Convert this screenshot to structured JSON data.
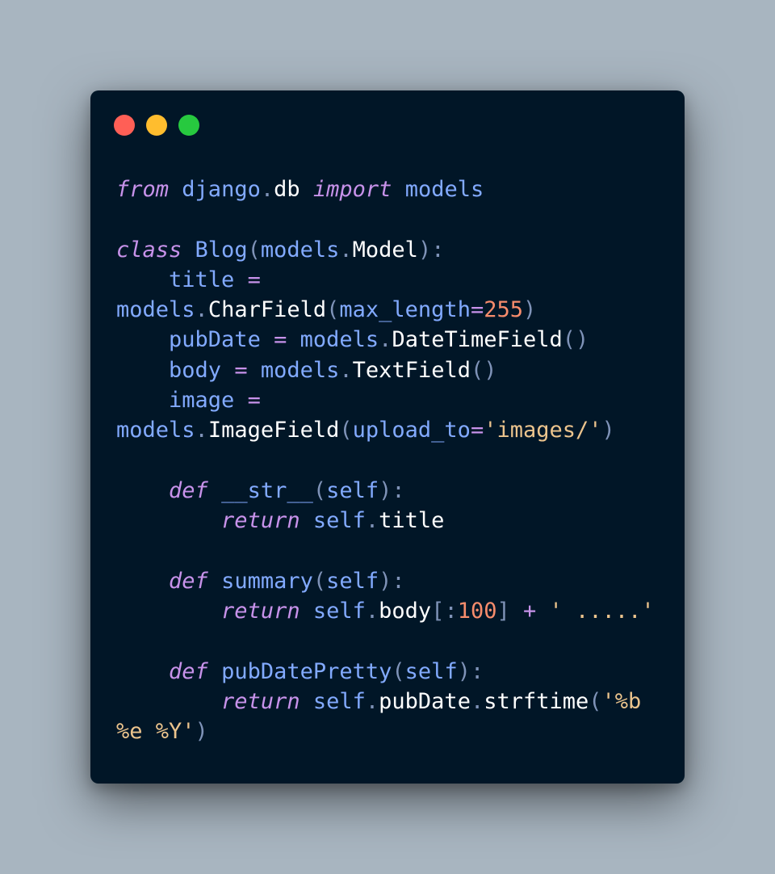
{
  "window": {
    "controls": [
      {
        "name": "close",
        "color": "#ff5f56"
      },
      {
        "name": "minimize",
        "color": "#ffbd2e"
      },
      {
        "name": "maximize",
        "color": "#27c93f"
      }
    ]
  },
  "code": {
    "lines": [
      [
        [
          "kw",
          "from"
        ],
        [
          "pl",
          " "
        ],
        [
          "nm",
          "django"
        ],
        [
          "pu",
          "."
        ],
        [
          "pl",
          "db "
        ],
        [
          "kw",
          "import"
        ],
        [
          "pl",
          " "
        ],
        [
          "nm",
          "models"
        ]
      ],
      [],
      [
        [
          "kw",
          "class"
        ],
        [
          "pl",
          " "
        ],
        [
          "nm",
          "Blog"
        ],
        [
          "pu",
          "("
        ],
        [
          "nm",
          "models"
        ],
        [
          "pu",
          "."
        ],
        [
          "pl",
          "Model"
        ],
        [
          "pu",
          "):"
        ]
      ],
      [
        [
          "pl",
          "    "
        ],
        [
          "nm",
          "title"
        ],
        [
          "pl",
          " "
        ],
        [
          "op",
          "="
        ]
      ],
      [
        [
          "nm",
          "models"
        ],
        [
          "pu",
          "."
        ],
        [
          "pl",
          "CharField"
        ],
        [
          "pu",
          "("
        ],
        [
          "nm",
          "max_length"
        ],
        [
          "op",
          "="
        ],
        [
          "num",
          "255"
        ],
        [
          "pu",
          ")"
        ]
      ],
      [
        [
          "pl",
          "    "
        ],
        [
          "nm",
          "pubDate"
        ],
        [
          "pl",
          " "
        ],
        [
          "op",
          "="
        ],
        [
          "pl",
          " "
        ],
        [
          "nm",
          "models"
        ],
        [
          "pu",
          "."
        ],
        [
          "pl",
          "DateTimeField"
        ],
        [
          "pu",
          "()"
        ]
      ],
      [
        [
          "pl",
          "    "
        ],
        [
          "nm",
          "body"
        ],
        [
          "pl",
          " "
        ],
        [
          "op",
          "="
        ],
        [
          "pl",
          " "
        ],
        [
          "nm",
          "models"
        ],
        [
          "pu",
          "."
        ],
        [
          "pl",
          "TextField"
        ],
        [
          "pu",
          "()"
        ]
      ],
      [
        [
          "pl",
          "    "
        ],
        [
          "nm",
          "image"
        ],
        [
          "pl",
          " "
        ],
        [
          "op",
          "="
        ]
      ],
      [
        [
          "nm",
          "models"
        ],
        [
          "pu",
          "."
        ],
        [
          "pl",
          "ImageField"
        ],
        [
          "pu",
          "("
        ],
        [
          "nm",
          "upload_to"
        ],
        [
          "op",
          "="
        ],
        [
          "str",
          "'images/'"
        ],
        [
          "pu",
          ")"
        ]
      ],
      [],
      [
        [
          "pl",
          "    "
        ],
        [
          "kw",
          "def"
        ],
        [
          "pl",
          " "
        ],
        [
          "nm",
          "__str__"
        ],
        [
          "pu",
          "("
        ],
        [
          "nm",
          "self"
        ],
        [
          "pu",
          "):"
        ]
      ],
      [
        [
          "pl",
          "        "
        ],
        [
          "kw",
          "return"
        ],
        [
          "pl",
          " "
        ],
        [
          "nm",
          "self"
        ],
        [
          "pu",
          "."
        ],
        [
          "pl",
          "title"
        ]
      ],
      [],
      [
        [
          "pl",
          "    "
        ],
        [
          "kw",
          "def"
        ],
        [
          "pl",
          " "
        ],
        [
          "nm",
          "summary"
        ],
        [
          "pu",
          "("
        ],
        [
          "nm",
          "self"
        ],
        [
          "pu",
          "):"
        ]
      ],
      [
        [
          "pl",
          "        "
        ],
        [
          "kw",
          "return"
        ],
        [
          "pl",
          " "
        ],
        [
          "nm",
          "self"
        ],
        [
          "pu",
          "."
        ],
        [
          "pl",
          "body"
        ],
        [
          "pu",
          "[:"
        ],
        [
          "num",
          "100"
        ],
        [
          "pu",
          "]"
        ],
        [
          "pl",
          " "
        ],
        [
          "op",
          "+"
        ],
        [
          "pl",
          " "
        ],
        [
          "str",
          "' .....'"
        ]
      ],
      [],
      [
        [
          "pl",
          "    "
        ],
        [
          "kw",
          "def"
        ],
        [
          "pl",
          " "
        ],
        [
          "nm",
          "pubDatePretty"
        ],
        [
          "pu",
          "("
        ],
        [
          "nm",
          "self"
        ],
        [
          "pu",
          "):"
        ]
      ],
      [
        [
          "pl",
          "        "
        ],
        [
          "kw",
          "return"
        ],
        [
          "pl",
          " "
        ],
        [
          "nm",
          "self"
        ],
        [
          "pu",
          "."
        ],
        [
          "pl",
          "pubDate"
        ],
        [
          "pu",
          "."
        ],
        [
          "pl",
          "strftime"
        ],
        [
          "pu",
          "("
        ],
        [
          "str",
          "'%b"
        ]
      ],
      [
        [
          "str",
          "%e %Y'"
        ],
        [
          "pu",
          ")"
        ]
      ]
    ]
  }
}
